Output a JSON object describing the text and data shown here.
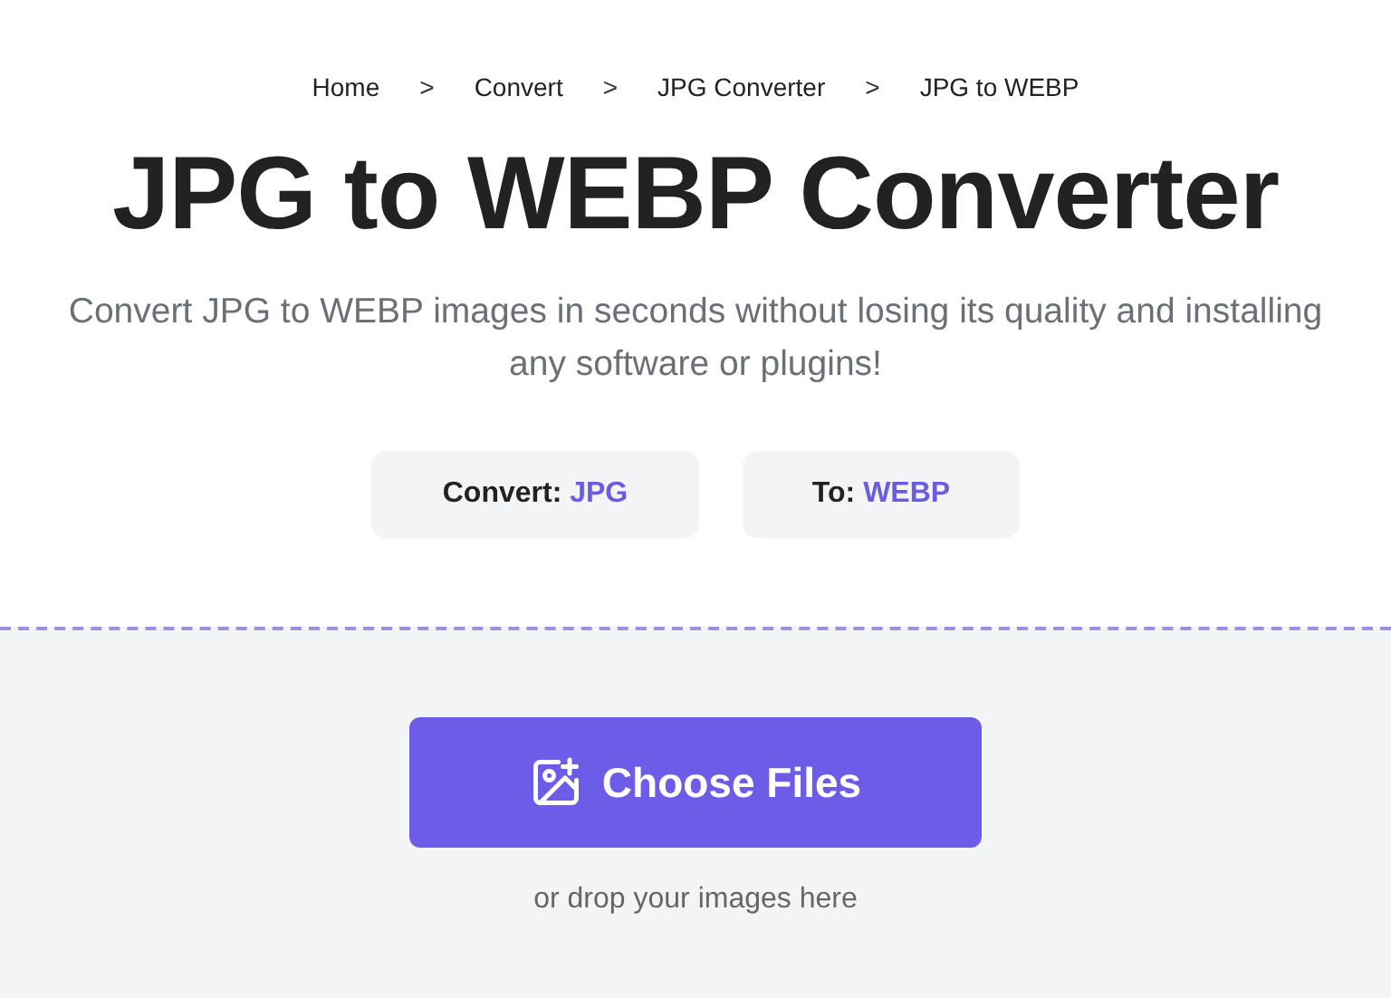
{
  "breadcrumb": [
    {
      "kind": "link",
      "label": "Home"
    },
    {
      "kind": "separator",
      "label": ">"
    },
    {
      "kind": "link",
      "label": "Convert"
    },
    {
      "kind": "separator",
      "label": ">"
    },
    {
      "kind": "link",
      "label": "JPG Converter"
    },
    {
      "kind": "separator",
      "label": ">"
    },
    {
      "kind": "current",
      "label": "JPG to WEBP"
    }
  ],
  "title": "JPG to WEBP Converter",
  "subtitle": "Convert JPG to WEBP images in seconds without losing its quality and installing any software or plugins!",
  "selectors": [
    {
      "label": "Convert:",
      "value": "JPG"
    },
    {
      "label": "To:",
      "value": "WEBP"
    }
  ],
  "upload": {
    "button": "Choose Files",
    "hint": "or drop your images here"
  }
}
